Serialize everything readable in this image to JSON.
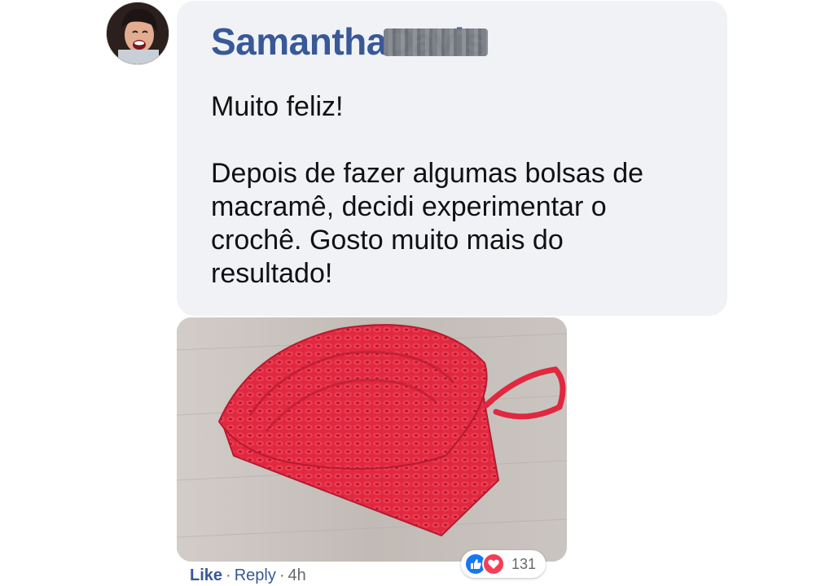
{
  "comment": {
    "author_first": "Samantha",
    "author_last": "Davis",
    "lines_p1": [
      "Muito feliz!"
    ],
    "lines_p2": [
      "Depois de fazer algumas bolsas de",
      "macramê, decidi experimentar o",
      "crochê. Gosto muito mais do",
      "resultado!"
    ]
  },
  "actions": {
    "like_label": "Like",
    "separator": "·",
    "reply_label": "Reply",
    "time": "4h"
  },
  "reactions": {
    "icons": [
      "like-icon",
      "love-icon"
    ],
    "count": "131"
  },
  "colors": {
    "name": "#385898",
    "bubble": "#f0f2f5",
    "like": "#1877f2",
    "love": "#f33e58",
    "crochet": "#e0283f"
  }
}
